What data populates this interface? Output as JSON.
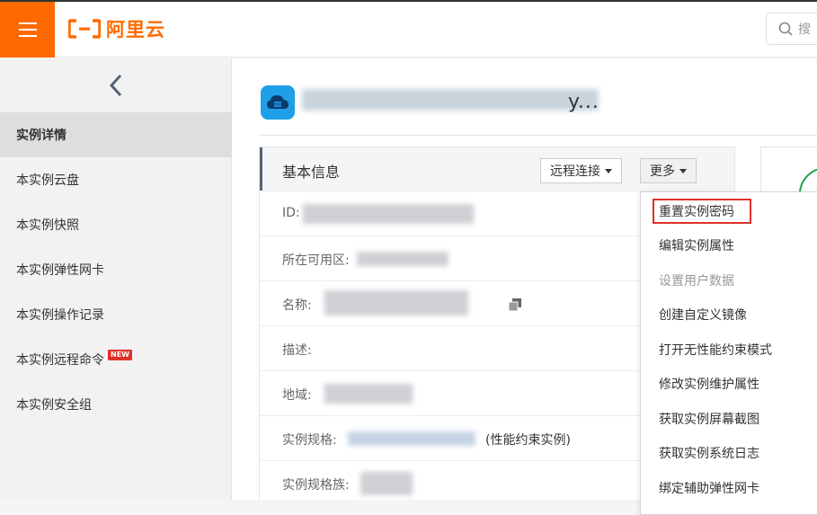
{
  "header": {
    "brand_name": "阿里云",
    "search_placeholder": "搜",
    "brand_color": "#ff6a00"
  },
  "sidebar": {
    "items": [
      {
        "label": "实例详情",
        "active": true
      },
      {
        "label": "本实例云盘"
      },
      {
        "label": "本实例快照"
      },
      {
        "label": "本实例弹性网卡"
      },
      {
        "label": "本实例操作记录"
      },
      {
        "label": "本实例远程命令",
        "badge": "NEW"
      },
      {
        "label": "本实例安全组"
      }
    ]
  },
  "instance": {
    "name_tail": "y..."
  },
  "panel": {
    "title": "基本信息",
    "remote_connect_label": "远程连接",
    "more_label": "更多",
    "rows": [
      {
        "label": "ID:"
      },
      {
        "label": "所在可用区:"
      },
      {
        "label": "名称:"
      },
      {
        "label": "描述:"
      },
      {
        "label": "地域:"
      },
      {
        "label": "实例规格:",
        "suffix": "(性能约束实例)"
      },
      {
        "label": "实例规格族:"
      }
    ]
  },
  "dropdown": {
    "items": [
      {
        "label": "重置实例密码",
        "highlighted": true
      },
      {
        "label": "编辑实例属性"
      },
      {
        "label": "设置用户数据",
        "disabled": true
      },
      {
        "label": "创建自定义镜像"
      },
      {
        "label": "打开无性能约束模式"
      },
      {
        "label": "修改实例维护属性"
      },
      {
        "label": "获取实例屏幕截图"
      },
      {
        "label": "获取实例系统日志"
      },
      {
        "label": "绑定辅助弹性网卡"
      }
    ]
  }
}
